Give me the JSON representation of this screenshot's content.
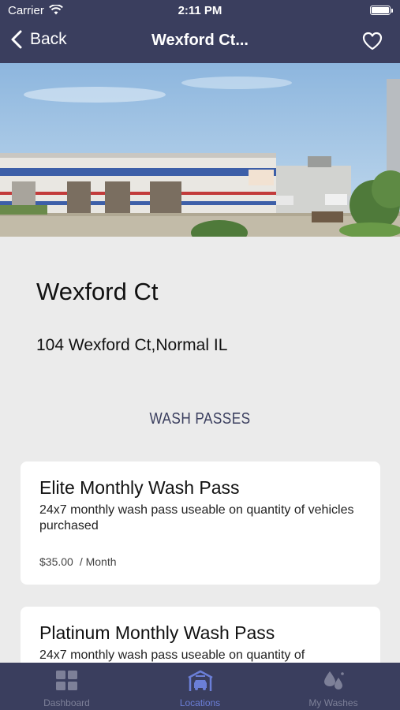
{
  "status_bar": {
    "carrier": "Carrier",
    "time": "2:11 PM"
  },
  "nav": {
    "back_label": "Back",
    "title": "Wexford Ct...",
    "favorite_icon": "heart-outline-icon"
  },
  "location": {
    "name": "Wexford Ct",
    "address": "104 Wexford Ct,Normal IL"
  },
  "passes_section": {
    "title": "WASH PASSES",
    "passes": [
      {
        "name": "Elite Monthly Wash Pass",
        "description": "24x7 monthly wash pass useable on quantity of vehicles purchased",
        "price": "$35.00",
        "period": "/ Month"
      },
      {
        "name": "Platinum Monthly Wash Pass",
        "description": "24x7 monthly wash pass useable on quantity of"
      }
    ]
  },
  "tab_bar": {
    "tabs": [
      {
        "label": "Dashboard",
        "icon": "grid-icon",
        "active": false
      },
      {
        "label": "Locations",
        "icon": "car-wash-icon",
        "active": true
      },
      {
        "label": "My Washes",
        "icon": "water-drops-icon",
        "active": false
      }
    ]
  },
  "colors": {
    "brand": "#3a3e5e",
    "active_tab": "#6b7fd8",
    "inactive_tab": "#7d8098",
    "background": "#ebebeb"
  }
}
